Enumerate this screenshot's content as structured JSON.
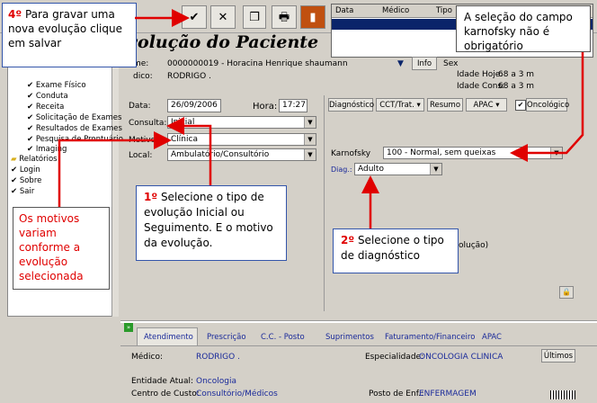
{
  "toolbar": {
    "callout_step": "4º",
    "callout_text": " Para gravar uma nova evolução clique em salvar",
    "grid_headers": [
      "Data",
      "Médico",
      "Tipo"
    ]
  },
  "header": {
    "title": "volução do Paciente",
    "patient_label": "me:",
    "patient_value": "0000000019 - Horacina Henrique shaumann",
    "medico_label": "dico:",
    "medico_value": "RODRIGO .",
    "info_button": "Info",
    "sex_label": "Sex",
    "idade_hoje_label": "Idade Hoje:",
    "idade_hoje_value": "68 a 3 m",
    "idade_cons_label": "Idade Cons:",
    "idade_cons_value": "68 a 3 m"
  },
  "callout_karnofsky": "A seleção do campo karnofsky não é obrigatório",
  "sidebar": {
    "items": [
      {
        "label": "Exame Físico"
      },
      {
        "label": "Conduta"
      },
      {
        "label": "Receita"
      },
      {
        "label": "Solicitação de Exames"
      },
      {
        "label": "Resultados de Exames"
      },
      {
        "label": "Pesquisa de Prontuário"
      },
      {
        "label": "Imaging"
      },
      {
        "label": "Relatórios"
      },
      {
        "label": "Login"
      },
      {
        "label": "Sobre"
      },
      {
        "label": "Sair"
      }
    ]
  },
  "callout_motivos": "Os motivos variam conforme a evolução selecionada",
  "form": {
    "data_label": "Data:",
    "data_value": "26/09/2006",
    "hora_label": "Hora:",
    "hora_value": "17:27",
    "consulta_label": "Consulta:",
    "consulta_value": "Inicial",
    "motivo_label": "Motivo:",
    "motivo_value": "Clínica",
    "local_label": "Local:",
    "local_value": "Ambulatório/Consultório"
  },
  "right_tabs": {
    "diagnostico": "Diagnóstico",
    "cct": "CCT/Trat.",
    "resumo": "Resumo",
    "apac": "APAC",
    "oncologico": "Oncológico",
    "karnofsky_label": "Karnofsky",
    "karnofsky_value": "100 - Normal, sem queixas",
    "diag_label": "Diag.:",
    "diag_value": "Adulto",
    "partial_text": "olução)"
  },
  "callout_step1": {
    "step": "1º",
    "text": " Selecione o tipo de evolução Inicial ou Seguimento. E o motivo da evolução."
  },
  "callout_step2": {
    "step": "2º",
    "text": " Selecione o tipo de diagnóstico"
  },
  "bottom": {
    "tabs": [
      "Atendimento",
      "Prescrição",
      "C.C. - Posto",
      "Suprimentos",
      "Faturamento/Financeiro",
      "APAC"
    ],
    "medico_label": "Médico:",
    "medico_value": "RODRIGO .",
    "especialidade_label": "Especialidade:",
    "especialidade_value": "ONCOLOGIA CLINICA",
    "ultimos_button": "Últimos",
    "entidade_label": "Entidade Atual:",
    "entidade_value": "Oncologia",
    "centro_label": "Centro de Custo:",
    "centro_value": "Consultório/Médicos",
    "posto_label": "Posto de Enf.:",
    "posto_value": "ENFERMAGEM"
  },
  "colors": {
    "accent": "#e00000",
    "header_bar": "#0a246a",
    "link": "#1a2a9a"
  }
}
